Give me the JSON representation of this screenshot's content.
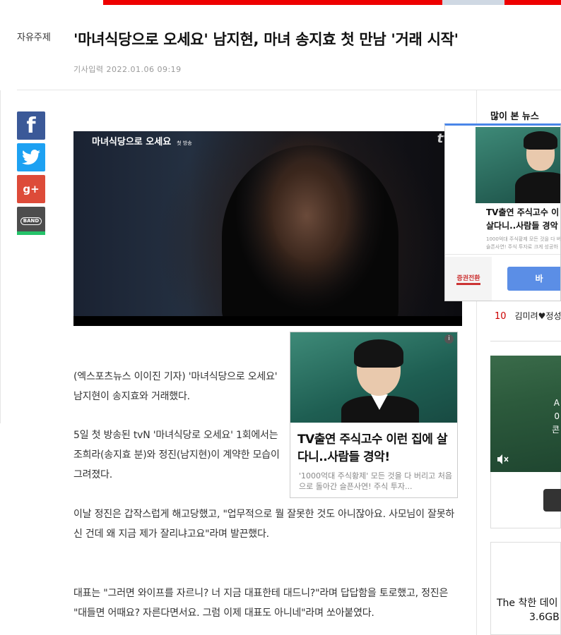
{
  "header": {
    "category": "자유주제",
    "headline": "'마녀식당으로 오세요' 남지현, 마녀 송지효 첫 만남 '거래 시작'",
    "meta_label": "기사입력",
    "meta_date": "2022.01.06 09:19"
  },
  "share": {
    "facebook": "f",
    "googleplus": "g+",
    "band": "BAND"
  },
  "video": {
    "logo": "마녀식당으로 오세요",
    "logo_sub": "첫 방송",
    "channel": "tvN"
  },
  "inline_ad": {
    "title": "TV출연 주식고수 이런 집에 살다니..사람들 경악!",
    "description": "'1000억대 주식황제' 모든 것을 다 버리고 처음으로 돌아간 슬픈사연! 주식 투자...",
    "info": "i"
  },
  "article": {
    "paragraphs": [
      "(엑스포츠뉴스 이이진 기자) '마녀식당으로 오세요' 남지현이 송지효와 거래했다.",
      "5일 첫 방송된 tvN '마녀식당로 오세요' 1회에서는 조희라(송지효 분)와 정진(남지현)이 계약한 모습이 그려졌다.",
      "이날 정진은 갑작스럽게 해고당했고, \"업무적으로 뭘 잘못한 것도 아니잖아요. 사모님이 잘못하신 건데 왜 지금 제가 잘리냐고요\"라며 발끈했다.",
      "대표는 \"그러면 와이프를 자르니? 너 지금 대표한테 대드니?\"라며 답답함을 토로했고, 정진은 \"대들면 어때요? 자른다면서요. 그럼 이제 대표도 아니네\"라며 쏘아붙였다."
    ]
  },
  "sidebar": {
    "most_viewed_title": "많이 본 뉴스",
    "rank_item": {
      "rank": "10",
      "text": "김미려♥정성"
    }
  },
  "overlay_ad": {
    "title_line1": "TV출연 주식고수 이",
    "title_line2": "살다니..사람들 경악",
    "desc_line1": "1000억대 주식황제 모든 것을 다 버",
    "desc_line2": "슬픈사연! 주식 투자로 크게 성공하",
    "brand": "증권전환",
    "button": "바"
  },
  "right_video": {
    "text_line1": "A",
    "text_line2": "0",
    "text_line3": "콘"
  },
  "right_ad2": {
    "line1": "The 착한 데이",
    "line2": "3.6GB"
  }
}
